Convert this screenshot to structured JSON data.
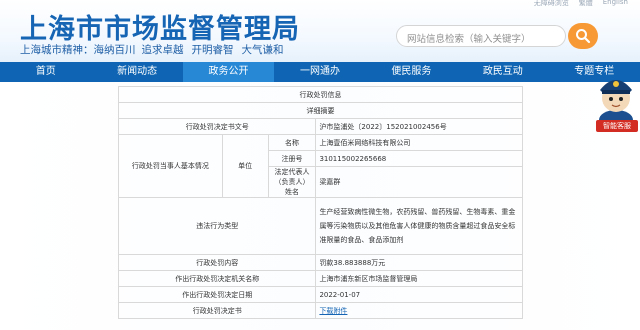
{
  "header": {
    "site_title": "上海市市场监督管理局",
    "top_links": [
      "无障碍浏览",
      "繁體",
      "English"
    ],
    "motto": [
      "上海城市精神：海纳百川",
      "追求卓越",
      "开明睿智",
      "大气谦和"
    ],
    "search_placeholder": "网站信息检索（输入关键字）"
  },
  "nav": [
    "首页",
    "新闻动态",
    "政务公开",
    "一网通办",
    "便民服务",
    "政民互动",
    "专题专栏"
  ],
  "mascot_badge": "智能客服",
  "table": {
    "section_title": "行政处罚信息",
    "subtitle": "详细摘要",
    "doc_no_label": "行政处罚决定书文号",
    "doc_no": "沪市监浦处〔2022〕152021002456号",
    "party_label": "行政处罚当事人基本情况",
    "unit_label": "单位",
    "name_label": "名称",
    "name": "上海壹佰米网络科技有限公司",
    "reg_label": "注册号",
    "reg": "310115002265668",
    "rep_label": "法定代表人（负责人）姓名",
    "rep": "梁嘉群",
    "violation_label": "违法行为类型",
    "violation": "生产经营致病性微生物，农药残留、兽药残留、生物毒素、重金属等污染物质以及其他危害人体健康的物质含量超过食品安全标准限量的食品、食品添加剂",
    "penalty_label": "行政处罚内容",
    "penalty": "罚款38.883888万元",
    "authority_label": "作出行政处罚决定机关名称",
    "authority": "上海市浦东新区市场监督管理局",
    "date_label": "作出行政处罚决定日期",
    "date": "2022-01-07",
    "doc_label": "行政处罚决定书",
    "doc_link": "下载附件"
  }
}
